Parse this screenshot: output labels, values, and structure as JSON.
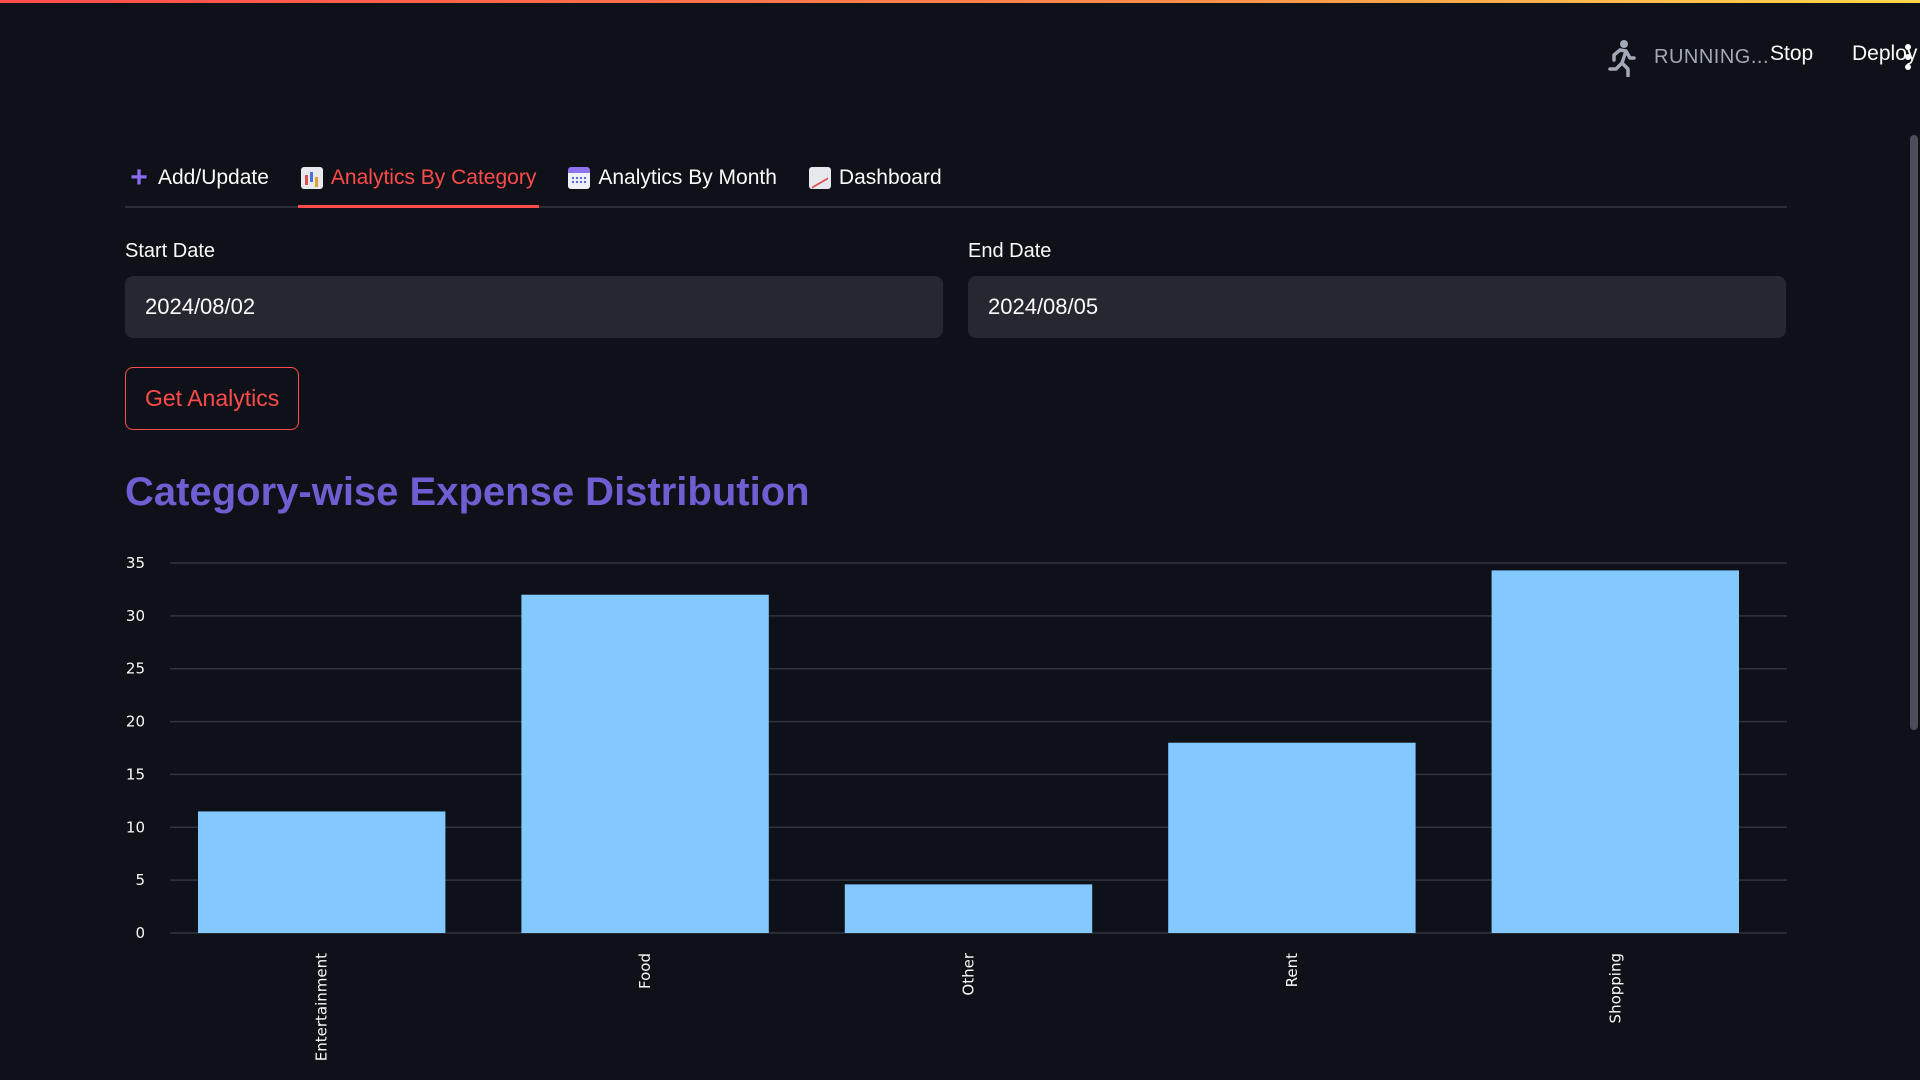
{
  "header": {
    "status": "RUNNING...",
    "stop_label": "Stop",
    "deploy_label": "Deploy"
  },
  "tabs": [
    {
      "label": "Add/Update",
      "icon": "plus-icon",
      "active": false
    },
    {
      "label": "Analytics By Category",
      "icon": "bar-chart-icon",
      "active": true
    },
    {
      "label": "Analytics By Month",
      "icon": "calendar-icon",
      "active": false
    },
    {
      "label": "Dashboard",
      "icon": "trend-chart-icon",
      "active": false
    }
  ],
  "form": {
    "start_date_label": "Start Date",
    "start_date_value": "2024/08/02",
    "end_date_label": "End Date",
    "end_date_value": "2024/08/05",
    "submit_label": "Get Analytics"
  },
  "colors": {
    "accent": "#ff4b4b",
    "title": "#6b5fd1",
    "bar": "#83c9ff",
    "background": "#0e1117"
  },
  "chart_data": {
    "type": "bar",
    "title": "Category-wise Expense Distribution",
    "categories": [
      "Entertainment",
      "Food",
      "Other",
      "Rent",
      "Shopping"
    ],
    "values": [
      11.5,
      32,
      4.6,
      18,
      34.3
    ],
    "ylim": [
      0,
      35
    ],
    "yticks": [
      0,
      5,
      10,
      15,
      20,
      25,
      30,
      35
    ],
    "grid": true
  }
}
